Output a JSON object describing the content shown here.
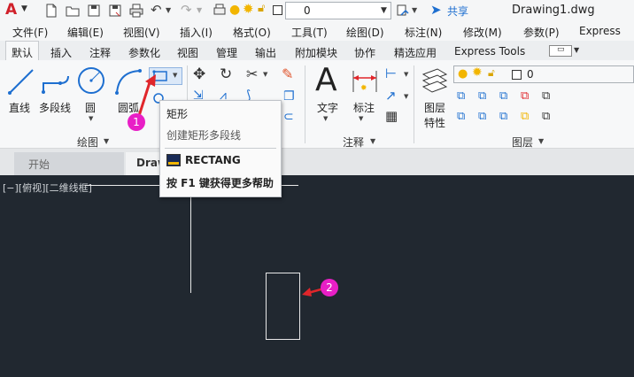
{
  "titlebar": {
    "logo": "A",
    "layer_value": "0",
    "share_label": "共享",
    "drawing_name": "Drawing1.dwg"
  },
  "menu": [
    {
      "label": "文件(F)"
    },
    {
      "label": "编辑(E)"
    },
    {
      "label": "视图(V)"
    },
    {
      "label": "插入(I)"
    },
    {
      "label": "格式(O)"
    },
    {
      "label": "工具(T)"
    },
    {
      "label": "绘图(D)"
    },
    {
      "label": "标注(N)"
    },
    {
      "label": "修改(M)"
    },
    {
      "label": "参数(P)"
    },
    {
      "label": "Express"
    }
  ],
  "ribbon_tabs": [
    {
      "label": "默认"
    },
    {
      "label": "插入"
    },
    {
      "label": "注释"
    },
    {
      "label": "参数化"
    },
    {
      "label": "视图"
    },
    {
      "label": "管理"
    },
    {
      "label": "输出"
    },
    {
      "label": "附加模块"
    },
    {
      "label": "协作"
    },
    {
      "label": "精选应用"
    },
    {
      "label": "Express Tools"
    }
  ],
  "ribbon": {
    "draw": {
      "line_label": "直线",
      "polyline_label": "多段线",
      "circle_label": "圆",
      "arc_label": "圆弧",
      "panel_title": "绘图"
    },
    "annotate": {
      "text_label": "文字",
      "dim_label": "标注",
      "panel_title": "注释"
    },
    "layers": {
      "props_label_1": "图层",
      "props_label_2": "特性",
      "layer_value": "0",
      "panel_title": "图层"
    }
  },
  "doc_tabs": [
    {
      "label": "开始"
    },
    {
      "label": "Draw"
    }
  ],
  "viewport_label": "[−][俯视][二维线框]",
  "tooltip": {
    "title": "矩形",
    "desc": "创建矩形多段线",
    "command": "RECTANG",
    "help": "按 F1 键获得更多帮助"
  },
  "callouts": [
    "1",
    "2"
  ],
  "colors": {
    "canvas": "#212830",
    "accent_red": "#e0262b",
    "badge": "#e81fc6",
    "ribbon_blue": "#1e6fd0"
  }
}
